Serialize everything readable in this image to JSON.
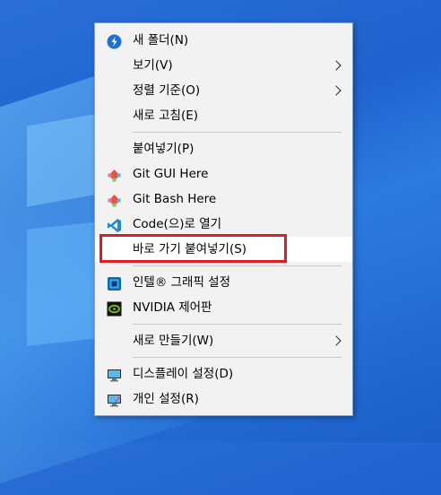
{
  "context_menu": {
    "items": [
      {
        "label": "새 폴더(N)",
        "icon": "new-folder-icon",
        "has_submenu": false
      },
      {
        "label": "보기(V)",
        "icon": null,
        "has_submenu": true
      },
      {
        "label": "정렬 기준(O)",
        "icon": null,
        "has_submenu": true
      },
      {
        "label": "새로 고침(E)",
        "icon": null,
        "has_submenu": false
      },
      {
        "label": "붙여넣기(P)",
        "icon": null,
        "has_submenu": false
      },
      {
        "label": "Git GUI Here",
        "icon": "git-icon",
        "has_submenu": false
      },
      {
        "label": "Git Bash Here",
        "icon": "git-icon",
        "has_submenu": false
      },
      {
        "label": "Code(으)로 열기",
        "icon": "vscode-icon",
        "has_submenu": false
      },
      {
        "label": "바로 가기 붙여넣기(S)",
        "icon": null,
        "has_submenu": false,
        "highlighted": true
      },
      {
        "label": "인텔® 그래픽 설정",
        "icon": "intel-graphics-icon",
        "has_submenu": false
      },
      {
        "label": "NVIDIA 제어판",
        "icon": "nvidia-icon",
        "has_submenu": false
      },
      {
        "label": "새로 만들기(W)",
        "icon": null,
        "has_submenu": true
      },
      {
        "label": "디스플레이 설정(D)",
        "icon": "display-icon",
        "has_submenu": false
      },
      {
        "label": "개인 설정(R)",
        "icon": "personalize-icon",
        "has_submenu": false
      }
    ]
  },
  "colors": {
    "desktop": "#1f62cf",
    "menu_bg": "#f2f2f2",
    "highlight_box": "#e01b24"
  }
}
